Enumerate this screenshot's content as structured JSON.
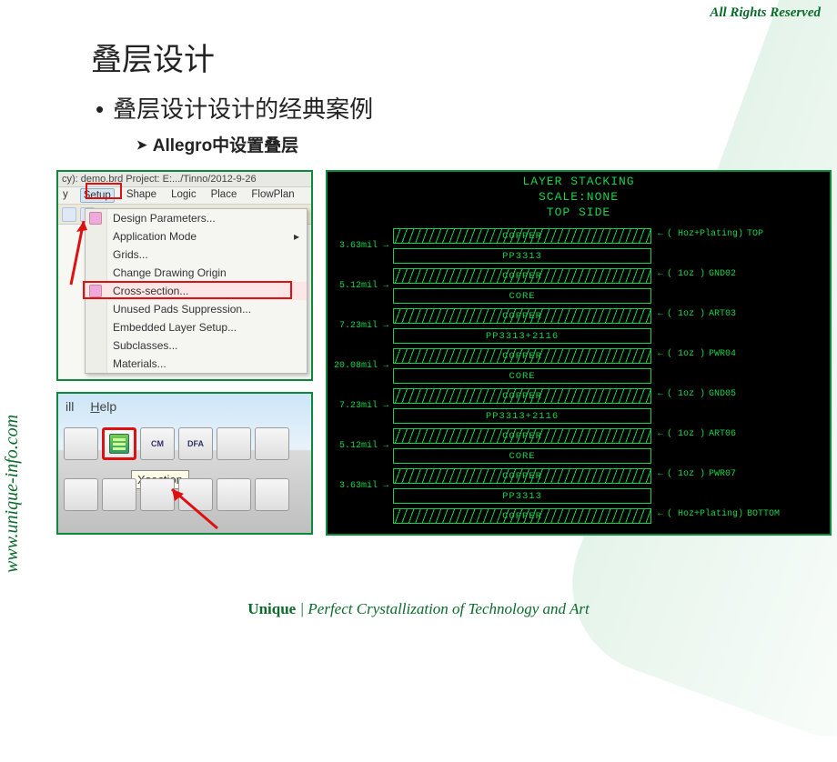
{
  "header": {
    "rights": "All Rights Reserved",
    "side_url": "www.unique-info.com",
    "title": "叠层设计",
    "bullet": "叠层设计设计的经典案例",
    "sub": "Allegro中设置叠层"
  },
  "footer": {
    "brand": "Unique",
    "sep": " | ",
    "slogan": "Perfect Crystallization of Technology and Art"
  },
  "shot1": {
    "titlebar": "cy): demo.brd   Project: E:.../Tinno/2012-9-26",
    "menus": [
      "y",
      "Setup",
      "Shape",
      "Logic",
      "Place",
      "FlowPlan"
    ],
    "selected_menu_index": 1,
    "items": [
      "Design Parameters...",
      "Application Mode",
      "Grids...",
      "Change Drawing Origin",
      "Cross-section...",
      "Unused Pads Suppression...",
      "Embedded Layer Setup...",
      "Subclasses...",
      "Materials..."
    ],
    "highlight_index": 4
  },
  "shot2": {
    "menu_items": [
      "ill",
      "Help"
    ],
    "tooltip": "Xsection",
    "row1_labels": [
      "",
      "",
      "CM",
      "DFA",
      "",
      ""
    ],
    "row2_labels": [
      "",
      "",
      "",
      "",
      "",
      ""
    ]
  },
  "stack": {
    "title1": "LAYER STACKING",
    "title2": "SCALE:NONE",
    "title3": "TOP SIDE",
    "rows": [
      {
        "label": "COPPER",
        "hatch": true,
        "right": "( Hoz+Plating)",
        "name": "TOP"
      },
      {
        "label": "PP3313",
        "thk": "3.63mil"
      },
      {
        "label": "COPPER",
        "hatch": true,
        "right": "(     1oz   )",
        "name": "GND02"
      },
      {
        "label": "CORE",
        "thk": "5.12mil"
      },
      {
        "label": "COPPER",
        "hatch": true,
        "right": "(     1oz   )",
        "name": "ART03"
      },
      {
        "label": "PP3313+2116",
        "thk": "7.23mil"
      },
      {
        "label": "COPPER",
        "hatch": true,
        "right": "(     1oz   )",
        "name": "PWR04"
      },
      {
        "label": "CORE",
        "thk": "20.08mil"
      },
      {
        "label": "COPPER",
        "hatch": true,
        "right": "(     1oz   )",
        "name": "GND05"
      },
      {
        "label": "PP3313+2116",
        "thk": "7.23mil"
      },
      {
        "label": "COPPER",
        "hatch": true,
        "right": "(     1oz   )",
        "name": "ART06"
      },
      {
        "label": "CORE",
        "thk": "5.12mil"
      },
      {
        "label": "COPPER",
        "hatch": true,
        "right": "(     1oz   )",
        "name": "PWR07"
      },
      {
        "label": "PP3313",
        "thk": "3.63mil"
      },
      {
        "label": "COPPER",
        "hatch": true,
        "right": "( Hoz+Plating)",
        "name": "BOTTOM"
      }
    ]
  }
}
